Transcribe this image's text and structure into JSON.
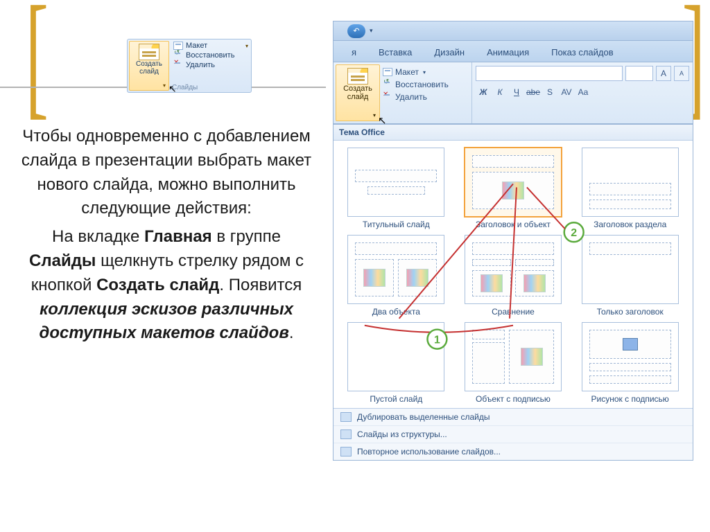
{
  "bracket_left": "[",
  "bracket_right": "]",
  "body": {
    "para1_a": "Чтобы одновременно с добавлением слайда в презентации выбрать макет нового слайда, можно выполнить следующие действия:",
    "para2_a": "На вкладке ",
    "para2_b": "Главная",
    "para2_c": " в группе ",
    "para2_d": "Слайды",
    "para2_e": " щелкнуть стрелку рядом с кнопкой ",
    "para2_f": "Создать слайд",
    "para2_g": ". Появится ",
    "para2_h": "коллекция эскизов различных доступных макетов слайдов",
    "para2_i": "."
  },
  "inset": {
    "new_slide": "Создать слайд",
    "layout": "Макет",
    "reset": "Восстановить",
    "delete": "Удалить",
    "group": "Слайды"
  },
  "app": {
    "tabs": [
      "я",
      "Вставка",
      "Дизайн",
      "Анимация",
      "Показ слайдов"
    ],
    "ribbon": {
      "new_slide": "Создать слайд",
      "layout": "Макет",
      "reset": "Восстановить",
      "delete": "Удалить"
    },
    "font_buttons": [
      "Ж",
      "К",
      "Ч",
      "abe",
      "S",
      "AV",
      "Aa"
    ],
    "gallery_header": "Тема Office",
    "layouts": [
      "Титульный слайд",
      "Заголовок и объект",
      "Заголовок раздела",
      "Два объекта",
      "Сравнение",
      "Только заголовок",
      "Пустой слайд",
      "Объект с подписью",
      "Рисунок с подписью"
    ],
    "callouts": {
      "c1": "1",
      "c2": "2"
    },
    "footer": [
      "Дублировать выделенные слайды",
      "Слайды из структуры...",
      "Повторное использование слайдов..."
    ]
  }
}
